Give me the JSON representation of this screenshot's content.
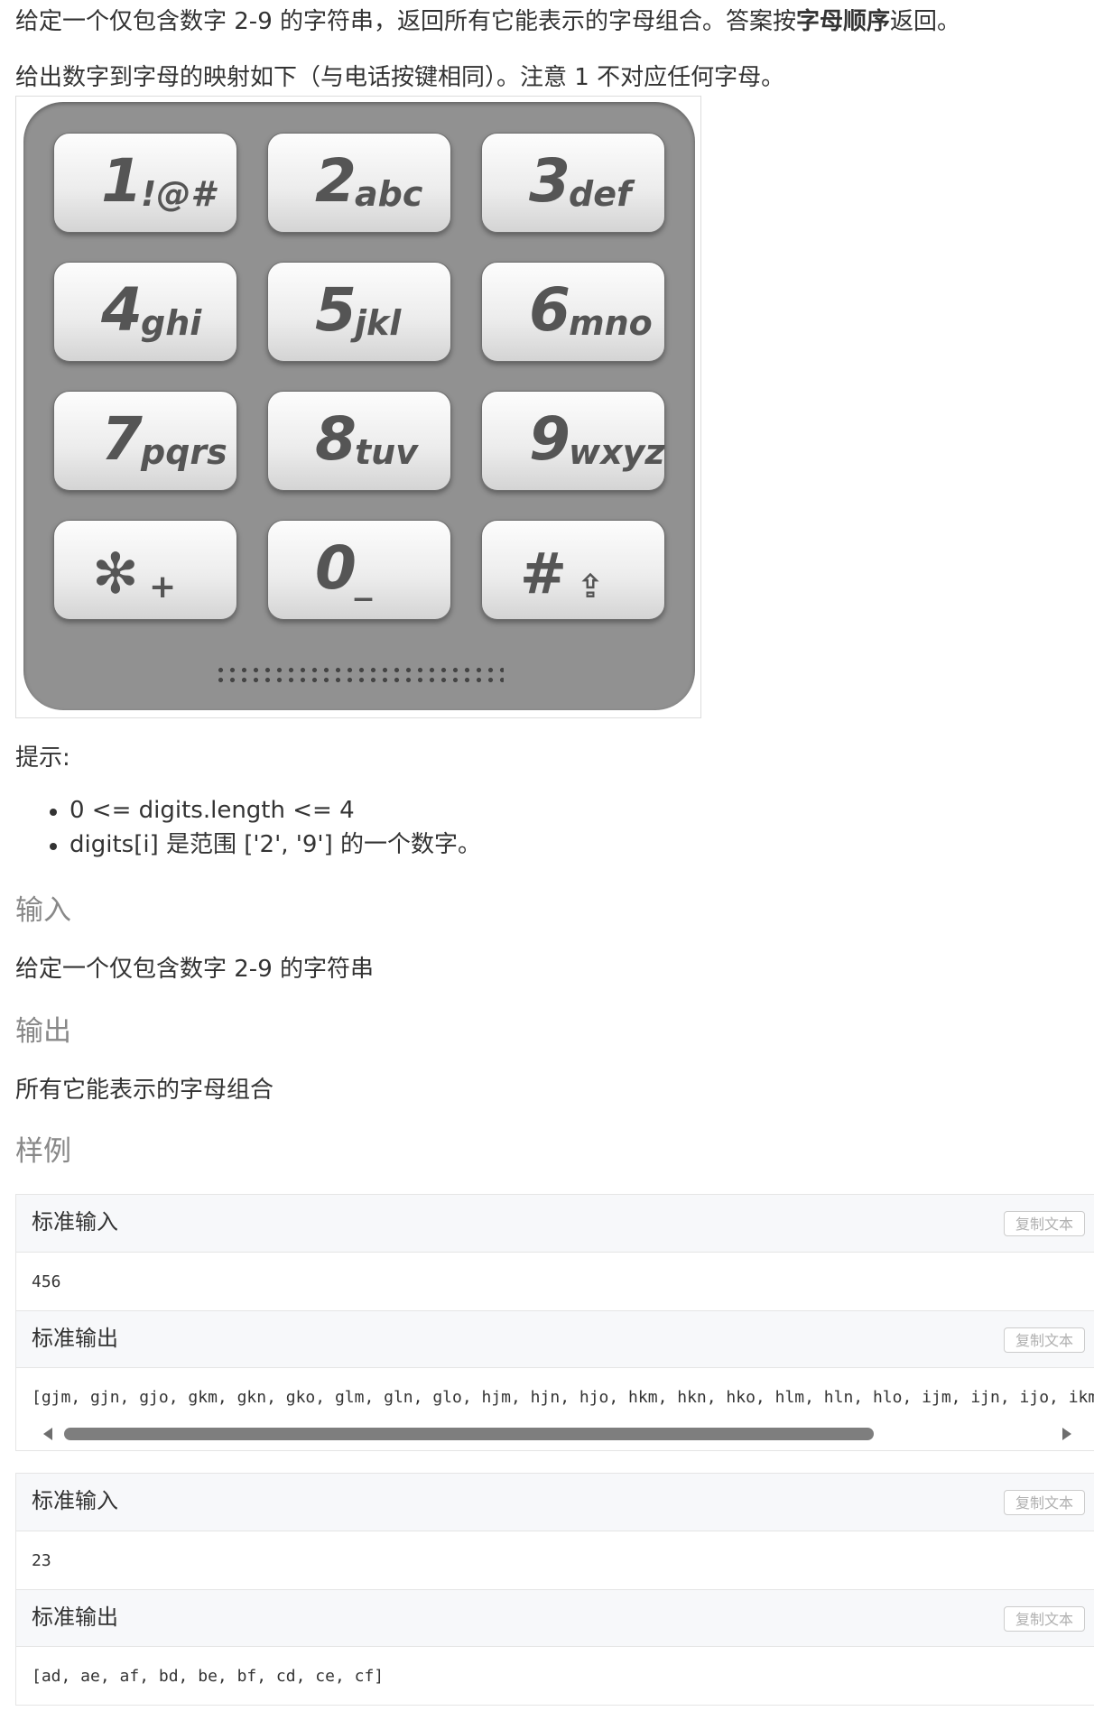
{
  "problem": {
    "intro_before": "给定一个仅包含数字 2-9 的字符串，返回所有它能表示的字母组合。答案按",
    "intro_bold": "字母顺序",
    "intro_after": "返回。",
    "mapping_note": "给出数字到字母的映射如下（与电话按键相同）。注意 1 不对应任何字母。"
  },
  "keypad": {
    "keys": [
      {
        "digit": "1",
        "letters": "!@#"
      },
      {
        "digit": "2",
        "letters": "abc"
      },
      {
        "digit": "3",
        "letters": "def"
      },
      {
        "digit": "4",
        "letters": "ghi"
      },
      {
        "digit": "5",
        "letters": "jkl"
      },
      {
        "digit": "6",
        "letters": "mno"
      },
      {
        "digit": "7",
        "letters": "pqrs"
      },
      {
        "digit": "8",
        "letters": "tuv"
      },
      {
        "digit": "9",
        "letters": "wxyz"
      },
      {
        "digit": "✻",
        "letters": "+"
      },
      {
        "digit": "0",
        "letters": "_"
      },
      {
        "digit": "#",
        "letters": "⇪"
      }
    ]
  },
  "hints": {
    "title": "提示:",
    "items": [
      "0 <= digits.length <= 4",
      "digits[i] 是范围 ['2', '9'] 的一个数字。"
    ]
  },
  "sections": {
    "input_heading": "输入",
    "input_text": "给定一个仅包含数字 2-9 的字符串",
    "output_heading": "输出",
    "output_text": "所有它能表示的字母组合",
    "examples_heading": "样例"
  },
  "examples": [
    {
      "input_label": "标准输入",
      "input_value": "456",
      "output_label": "标准输出",
      "output_value": "[gjm, gjn, gjo, gkm, gkn, gko, glm, gln, glo, hjm, hjn, hjo, hkm, hkn, hko, hlm, hln, hlo, ijm, ijn, ijo, ikm",
      "copy_label": "复制文本"
    },
    {
      "input_label": "标准输入",
      "input_value": "23",
      "output_label": "标准输出",
      "output_value": "[ad, ae, af, bd, be, bf, cd, ce, cf]",
      "copy_label": "复制文本"
    }
  ],
  "colors": {
    "text": "#333333",
    "heading": "#888888",
    "panel_header": "#f7f8fa",
    "keypad_background": "#919191"
  }
}
